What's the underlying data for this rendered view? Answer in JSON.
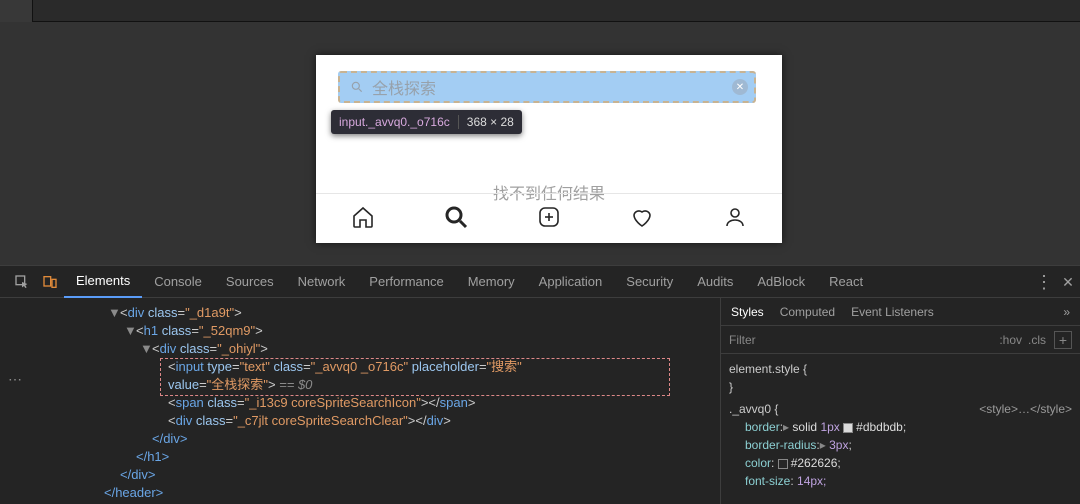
{
  "preview": {
    "search_placeholder": "全栈探索",
    "no_results": "找不到任何结果",
    "tooltip_selector": "input._avvq0._o716c",
    "tooltip_dims": "368 × 28"
  },
  "devtools": {
    "tabs": [
      "Elements",
      "Console",
      "Sources",
      "Network",
      "Performance",
      "Memory",
      "Application",
      "Security",
      "Audits",
      "AdBlock",
      "React"
    ],
    "active_tab": "Elements",
    "dom": {
      "l1": {
        "tag": "div",
        "cls": "_d1a9t"
      },
      "l2": {
        "tag": "h1",
        "cls": "_52qm9"
      },
      "l3": {
        "tag": "div",
        "cls": "_ohiyl"
      },
      "l4": {
        "tag": "input",
        "type": "text",
        "cls": "_avvq0 _o716c",
        "placeholder": "搜索",
        "value": "全栈探索",
        "eq": " == $0"
      },
      "l5": {
        "tag": "span",
        "cls": "_i13c9 coreSpriteSearchIcon"
      },
      "l6": {
        "tag": "div",
        "cls": "_c7jlt coreSpriteSearchClear"
      },
      "c_div": "</div>",
      "c_h1": "</h1>",
      "c_header": "</header>"
    },
    "styles": {
      "tabs": [
        "Styles",
        "Computed",
        "Event Listeners"
      ],
      "active": "Styles",
      "filter": "Filter",
      "hov": ":hov",
      "cls": ".cls",
      "elem_style": "element.style",
      "rule_sel": "._avvq0",
      "rule_src": "<style>…</style>",
      "p_border": "border",
      "v_border_style": "solid",
      "v_border_w": "1px",
      "v_border_c": "#dbdbdb",
      "p_radius": "border-radius",
      "v_radius": "3px",
      "p_color": "color",
      "v_color": "#262626",
      "p_fs": "font-size",
      "v_fs": "14px;",
      "open_brace": " {",
      "close_brace": "}"
    }
  }
}
